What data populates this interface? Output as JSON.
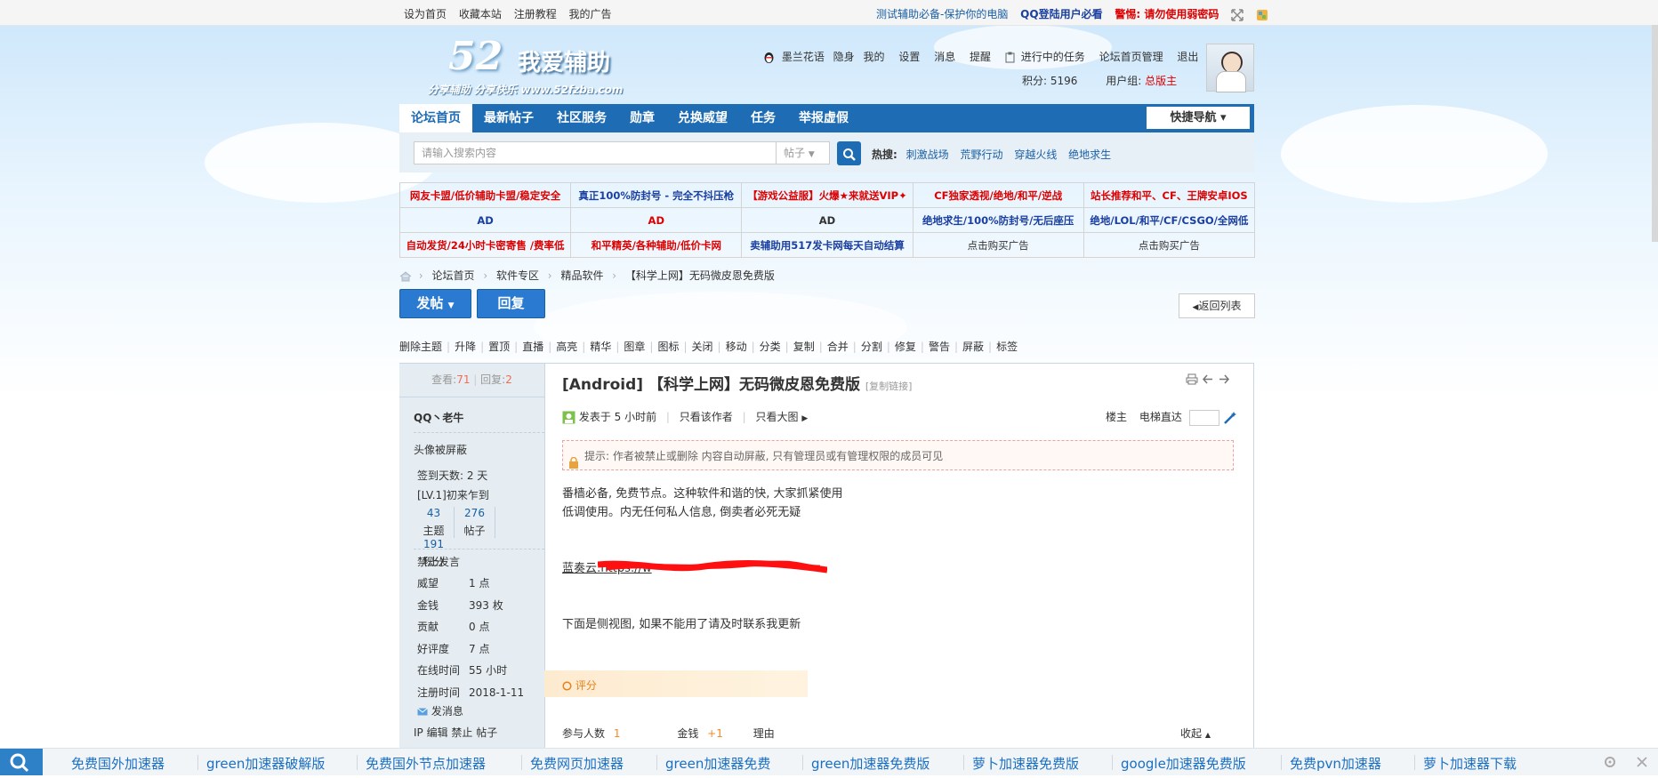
{
  "topbar": {
    "links": [
      "设为首页",
      "收藏本站",
      "注册教程",
      "我的广告"
    ],
    "right_note": "测试辅助必备-保护你的电脑",
    "qq_note": "QQ登陆用户必看",
    "warn": "警惕: 请勿使用弱密码"
  },
  "header": {
    "logo_num": "52",
    "logo_text": "我爱辅助",
    "logo_sub": "分享辅助  分享快乐  www.52fzba.com",
    "user": "墨兰花语",
    "user_links": [
      "隐身",
      "我的",
      "设置",
      "消息",
      "提醒",
      "进行中的任务",
      "论坛首页管理",
      "退出"
    ],
    "points": "积分: 5196",
    "group": "用户组:",
    "group_value": "总版主"
  },
  "nav": {
    "items": [
      "论坛首页",
      "最新帖子",
      "社区服务",
      "勋章",
      "兑换威望",
      "任务",
      "举报虚假"
    ],
    "quick": "快捷导航"
  },
  "search": {
    "placeholder": "请输入搜索内容",
    "type": "帖子",
    "hot_label": "热搜:",
    "hot": [
      "刺激战场",
      "荒野行动",
      "穿越火线",
      "绝地求生"
    ]
  },
  "ads": {
    "rows": [
      [
        {
          "text": "网友卡盟/低价辅助卡盟/稳定安全",
          "color": "#d00"
        },
        {
          "text": "真正100%防封号 - 完全不抖压枪",
          "color": "#1a3fa0"
        },
        {
          "text": "【游戏公益服】火爆★来就送VIP✦",
          "color": "#d00"
        },
        {
          "text": "CF独家透视/绝地/和平/逆战",
          "color": "#d00"
        },
        {
          "text": "站长推荐和平、CF、王牌安卓IOS",
          "color": "#d00"
        }
      ],
      [
        {
          "text": "AD",
          "color": "#1a3fa0"
        },
        {
          "text": "AD",
          "color": "#d00"
        },
        {
          "text": "AD",
          "color": "#333"
        },
        {
          "text": "绝地求生/100%防封号/无后座压",
          "color": "#1a3fa0"
        },
        {
          "text": "绝地/LOL/和平/CF/CSGO/全网低",
          "color": "#1a3fa0"
        }
      ],
      [
        {
          "text": "自动发货/24小时卡密寄售 /费率低",
          "color": "#d00"
        },
        {
          "text": "和平精英/各种辅助/低价卡网",
          "color": "#d00"
        },
        {
          "text": "卖辅助用517发卡网每天自动结算",
          "color": "#1a3fa0"
        },
        {
          "text": "点击购买广告",
          "color": "#333"
        },
        {
          "text": "点击购买广告",
          "color": "#333"
        }
      ]
    ]
  },
  "breadcrumb": [
    "论坛首页",
    "软件专区",
    "精品软件",
    "【科学上网】无码微皮恩免费版"
  ],
  "actions": {
    "post": "发帖",
    "reply": "回复",
    "back": "返回列表"
  },
  "modbar": [
    "删除主题",
    "升降",
    "置顶",
    "直播",
    "高亮",
    "精华",
    "图章",
    "图标",
    "关闭",
    "移动",
    "分类",
    "复制",
    "合并",
    "分割",
    "修复",
    "警告",
    "屏蔽",
    "标签"
  ],
  "thread": {
    "views_label": "查看:",
    "views": "71",
    "replies_label": "回复:",
    "replies": "2",
    "title": "[Android] 【科学上网】无码微皮恩免费版",
    "copy_link": "[复制链接]",
    "posted": "发表于 5 小时前",
    "only_author": "只看该作者",
    "only_big": "只看大图",
    "floor": "楼主",
    "jump": "电梯直达",
    "notice": "提示: 作者被禁止或删除 内容自动屏蔽, 只有管理员或有管理权限的成员可见",
    "body": [
      "番樯必备, 免费节点。这种软件和谐的快, 大家抓紧使用",
      "低调使用。内无任何私人信息, 倒卖者必死无疑",
      "蓝奏云:https://w",
      "下面是侧视图, 如果不能用了请及时联系我更新"
    ],
    "rate": "评分",
    "rate_people": "参与人数",
    "rate_people_val": "1",
    "rate_money": "金钱",
    "rate_money_val": "+1",
    "rate_reason": "理由",
    "rate_collapse": "收起"
  },
  "author": {
    "name": "QQ丶老牛",
    "avatar_note": "头像被屏蔽",
    "signin": "签到天数: 2 天",
    "level": "[LV.1]初来乍到",
    "stats": [
      {
        "num": "43",
        "label": "主题"
      },
      {
        "num": "276",
        "label": "帖子"
      },
      {
        "num": "191",
        "label": "积分"
      }
    ],
    "banned": "禁止发言",
    "fields": [
      {
        "k": "威望",
        "v": "1 点"
      },
      {
        "k": "金钱",
        "v": "393 枚"
      },
      {
        "k": "贡献",
        "v": "0 点"
      },
      {
        "k": "好评度",
        "v": "7 点"
      },
      {
        "k": "在线时间",
        "v": "55 小时"
      },
      {
        "k": "注册时间",
        "v": "2018-1-11"
      }
    ],
    "msg": "发消息",
    "ip_tools": "IP 编辑 禁止 帖子"
  },
  "bottom": {
    "items": [
      "免费国外加速器",
      "green加速器破解版",
      "免费国外节点加速器",
      "免费网页加速器",
      "green加速器免费",
      "green加速器免费版",
      "萝卜加速器免费版",
      "google加速器免费版",
      "免费pvn加速器",
      "萝卜加速器下载"
    ]
  }
}
